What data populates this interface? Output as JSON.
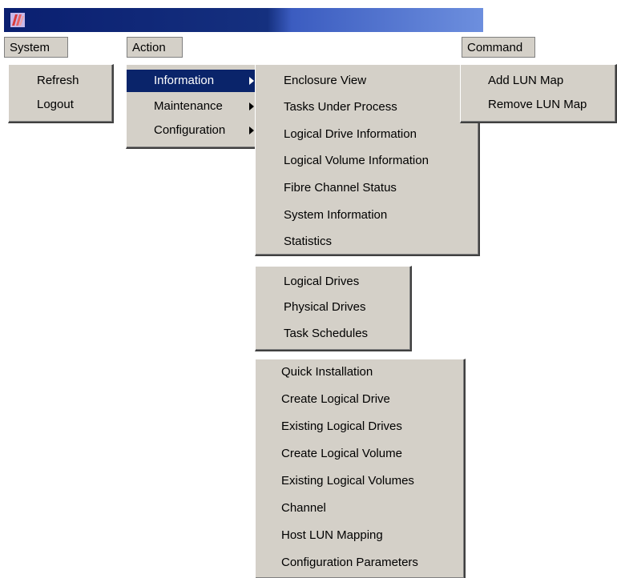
{
  "menubar": {
    "system": "System",
    "action": "Action",
    "command": "Command"
  },
  "system_menu": [
    "Refresh",
    "Logout"
  ],
  "action_menu": [
    {
      "label": "Information",
      "submenu": true,
      "selected": true
    },
    {
      "label": "Maintenance",
      "submenu": true,
      "selected": false
    },
    {
      "label": "Configuration",
      "submenu": true,
      "selected": false
    }
  ],
  "information_menu": [
    "Enclosure View",
    "Tasks Under Process",
    "Logical Drive Information",
    "Logical Volume Information",
    "Fibre Channel Status",
    "System Information",
    "Statistics"
  ],
  "maintenance_menu": [
    "Logical Drives",
    "Physical Drives",
    "Task Schedules"
  ],
  "configuration_menu": [
    "Quick Installation",
    "Create Logical Drive",
    "Existing Logical Drives",
    "Create Logical Volume",
    "Existing Logical Volumes",
    "Channel",
    "Host LUN Mapping",
    "Configuration Parameters"
  ],
  "command_menu": [
    "Add LUN Map",
    "Remove LUN Map"
  ],
  "colors": {
    "menu_bg": "#d4d0c8",
    "highlight": "#0a246a",
    "titlebar": "#0a1f70"
  }
}
